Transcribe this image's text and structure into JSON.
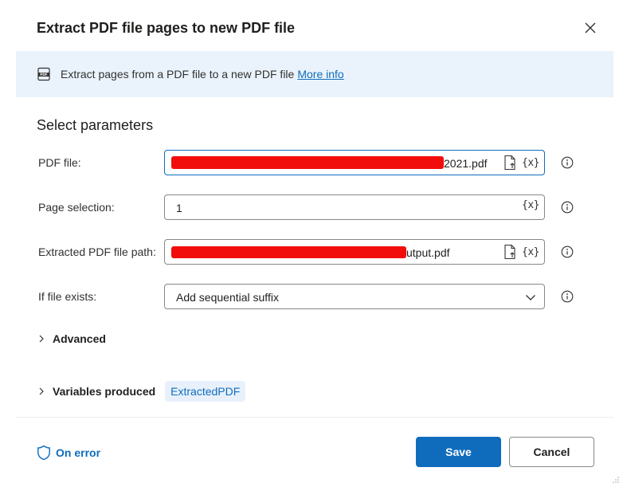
{
  "dialog": {
    "title": "Extract PDF file pages to new PDF file",
    "close_icon": "close-icon"
  },
  "banner": {
    "icon": "pdf-icon",
    "description": "Extract pages from a PDF file to a new PDF file",
    "link": "More info"
  },
  "section": {
    "title": "Select parameters"
  },
  "params": {
    "pdf_file": {
      "label": "PDF file:",
      "value_visible": "2021.pdf",
      "redacted": true,
      "icons": [
        "file-icon",
        "variable-icon"
      ],
      "var_glyph": "{x}"
    },
    "page_selection": {
      "label": "Page selection:",
      "value": "1",
      "icons": [
        "variable-icon"
      ],
      "var_glyph": "{x}"
    },
    "extracted_path": {
      "label": "Extracted PDF file path:",
      "value_visible": "utput.pdf",
      "redacted": true,
      "icons": [
        "file-icon",
        "variable-icon"
      ],
      "var_glyph": "{x}"
    },
    "if_file_exists": {
      "label": "If file exists:",
      "selected": "Add sequential suffix"
    }
  },
  "advanced": {
    "label": "Advanced"
  },
  "variables": {
    "label": "Variables produced",
    "chip": "ExtractedPDF"
  },
  "footer": {
    "on_error": "On error",
    "save": "Save",
    "cancel": "Cancel"
  },
  "colors": {
    "accent": "#0f6cbd",
    "banner_bg": "#eaf3fc",
    "redaction": "#f20d0d"
  }
}
